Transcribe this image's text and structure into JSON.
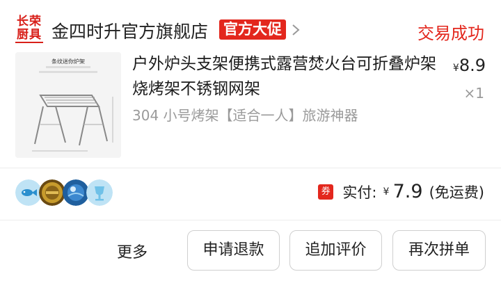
{
  "shop": {
    "logo_line1": "长荣",
    "logo_line2": "厨具",
    "name": "金四时升官方旗舰店",
    "promo_badge": "官方大促",
    "status": "交易成功"
  },
  "product": {
    "image_caption": "条纹迷你炉架",
    "title": "户外炉头支架便携式露营焚火台可折叠炉架烧烤架不锈钢网架",
    "variant": "304 小号烤架【适合一人】旅游神器",
    "price_currency": "¥",
    "price": "8.9",
    "quantity": "×1"
  },
  "payment": {
    "icon_text": "券",
    "label": "实付:",
    "currency": "¥",
    "amount": "7.9",
    "note": "(免运费)"
  },
  "actions": {
    "more": "更多",
    "refund": "申请退款",
    "add_review": "追加评价",
    "buy_again": "再次拼单"
  },
  "share_icons": [
    "fish-share-icon",
    "gold-coin-icon",
    "blue-orb-icon",
    "trophy-cup-icon"
  ],
  "colors": {
    "accent": "#e3271d",
    "muted_text": "#9a9a9a",
    "button_border": "#cfcfcf"
  }
}
